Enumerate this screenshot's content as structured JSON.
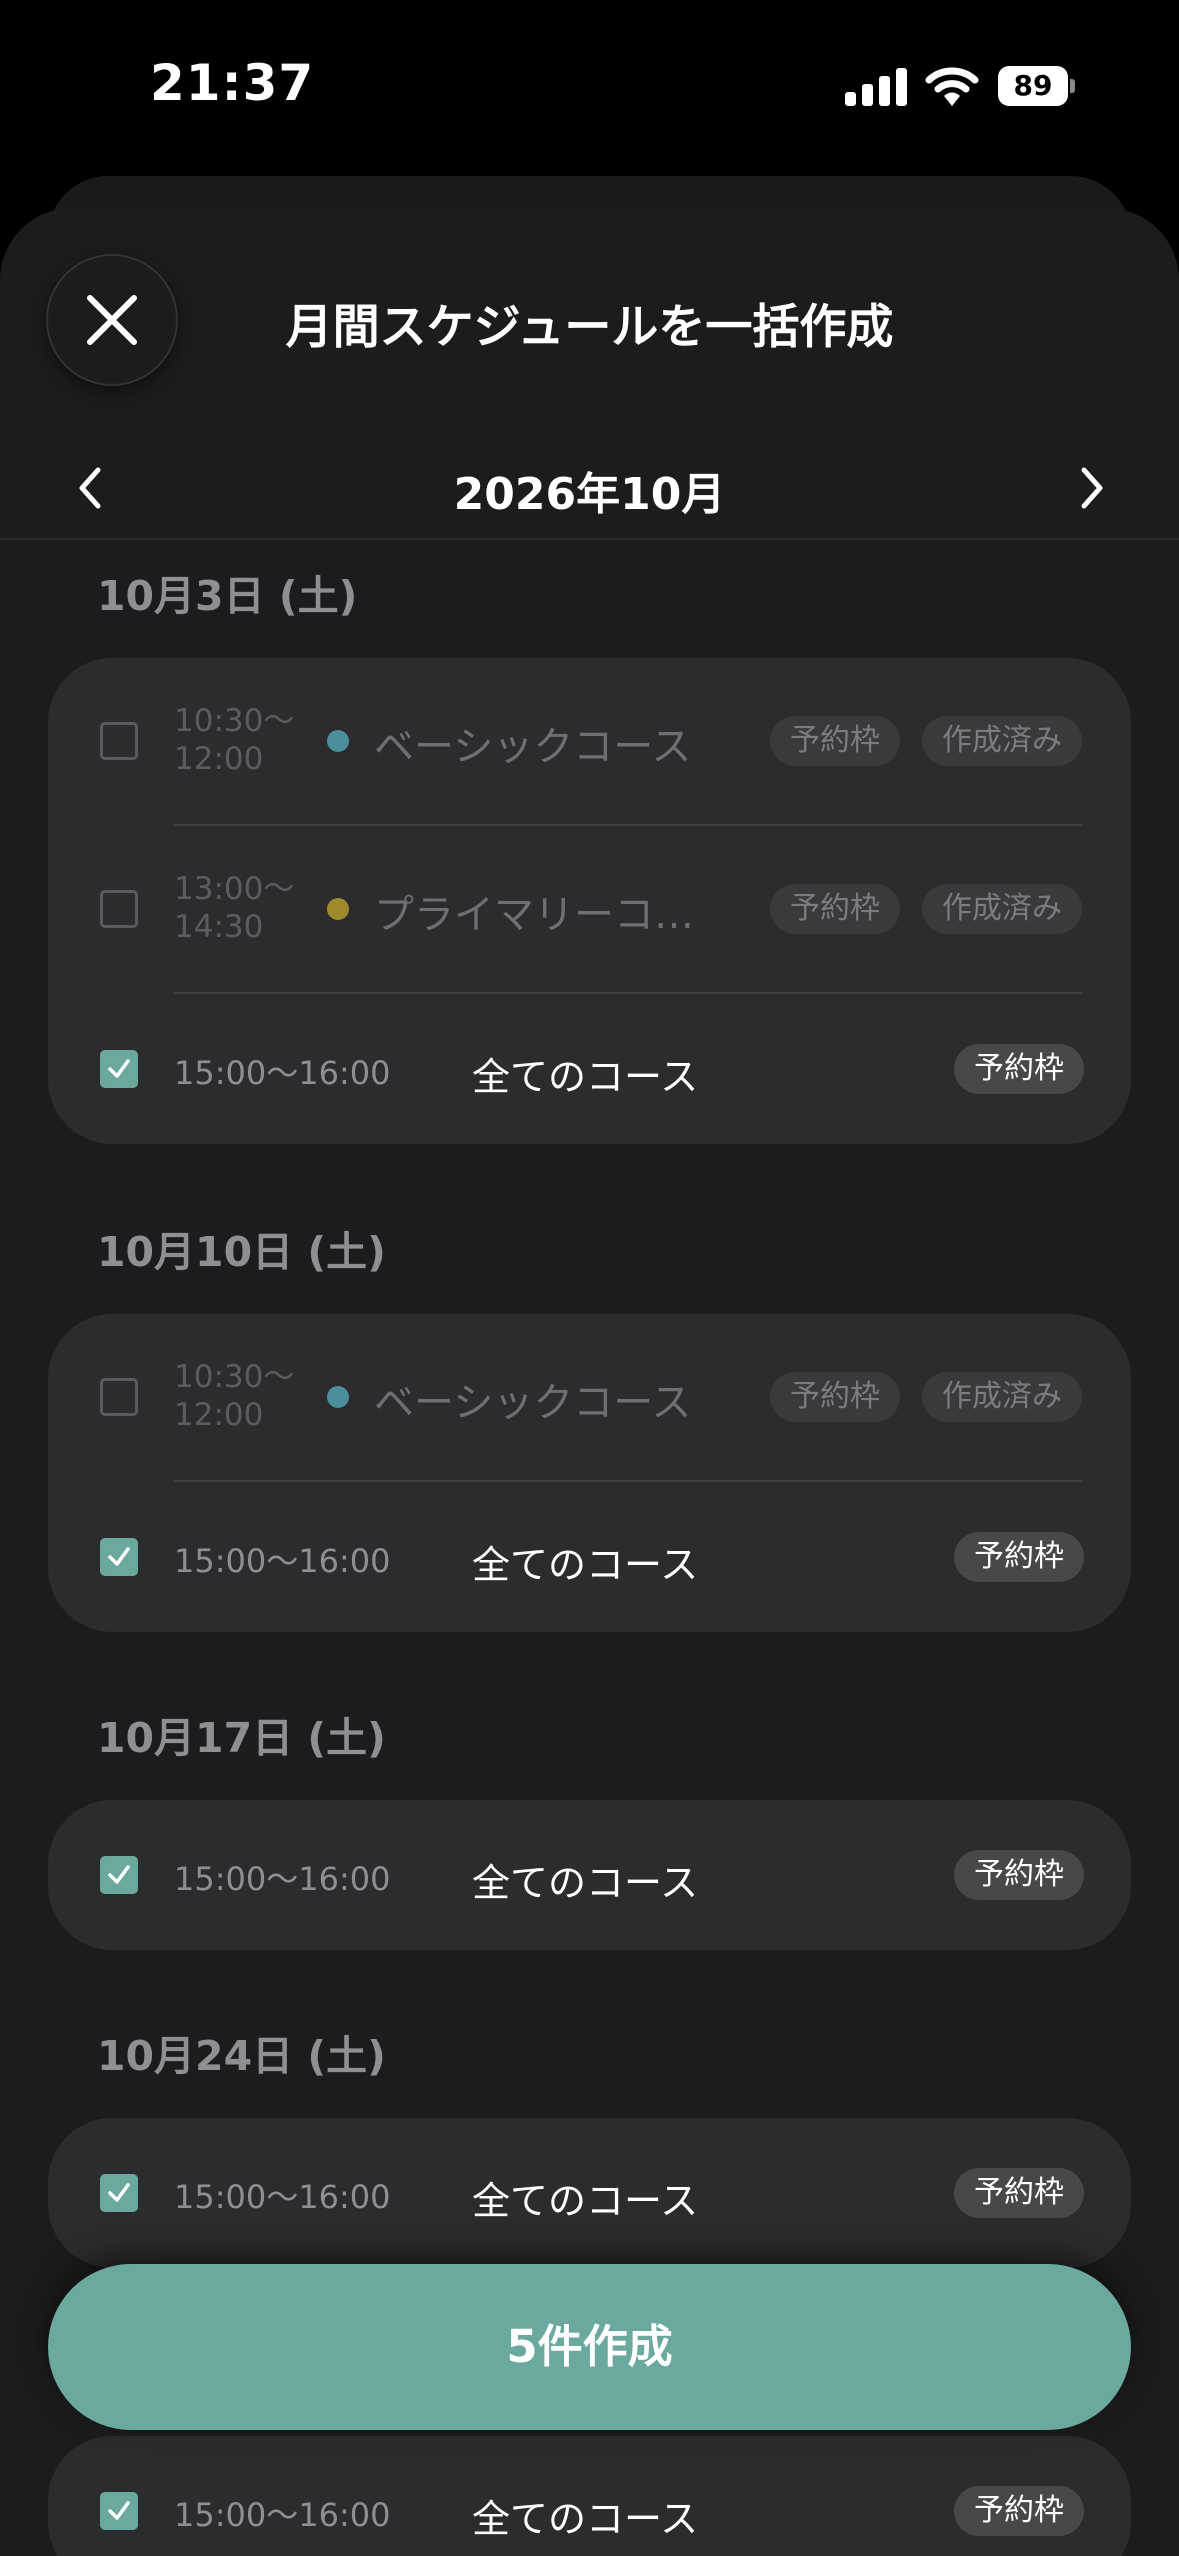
{
  "status_bar": {
    "time": "21:37",
    "battery": "89"
  },
  "sheet": {
    "title": "月間スケジュールを一括作成",
    "close_icon": "close-icon"
  },
  "month_nav": {
    "label": "2026年10月",
    "prev_icon": "chevron-left-icon",
    "next_icon": "chevron-right-icon"
  },
  "colors": {
    "accent": "#6ba99e",
    "basic_dot": "#4a8f9a",
    "primary_dot": "#a08a2c",
    "sheet_bg": "#1c1c1e",
    "card_bg": "#2c2c2e"
  },
  "groups": [
    {
      "date": "10月3日 (土)",
      "rows": [
        {
          "checked": false,
          "time_start": "10:30〜",
          "time_end": "12:00",
          "course": "ベーシックコース",
          "badges": [
            "予約枠",
            "作成済み"
          ]
        },
        {
          "checked": false,
          "time_start": "13:00〜",
          "time_end": "14:30",
          "course": "プライマリーコ…",
          "badges": [
            "予約枠",
            "作成済み"
          ]
        },
        {
          "checked": true,
          "time": "15:00〜16:00",
          "course": "全てのコース",
          "badges": [
            "予約枠"
          ]
        }
      ]
    },
    {
      "date": "10月10日 (土)",
      "rows": [
        {
          "checked": false,
          "time_start": "10:30〜",
          "time_end": "12:00",
          "course": "ベーシックコース",
          "badges": [
            "予約枠",
            "作成済み"
          ]
        },
        {
          "checked": true,
          "time": "15:00〜16:00",
          "course": "全てのコース",
          "badges": [
            "予約枠"
          ]
        }
      ]
    },
    {
      "date": "10月17日 (土)",
      "rows": [
        {
          "checked": true,
          "time": "15:00〜16:00",
          "course": "全てのコース",
          "badges": [
            "予約枠"
          ]
        }
      ]
    },
    {
      "date": "10月24日 (土)",
      "rows": [
        {
          "checked": true,
          "time": "15:00〜16:00",
          "course": "全てのコース",
          "badges": [
            "予約枠"
          ]
        }
      ]
    },
    {
      "date": "",
      "rows": [
        {
          "checked": true,
          "time": "15:00〜16:00",
          "course": "全てのコース",
          "badges": [
            "予約枠"
          ]
        }
      ]
    }
  ],
  "create_button": {
    "label": "5件作成"
  }
}
